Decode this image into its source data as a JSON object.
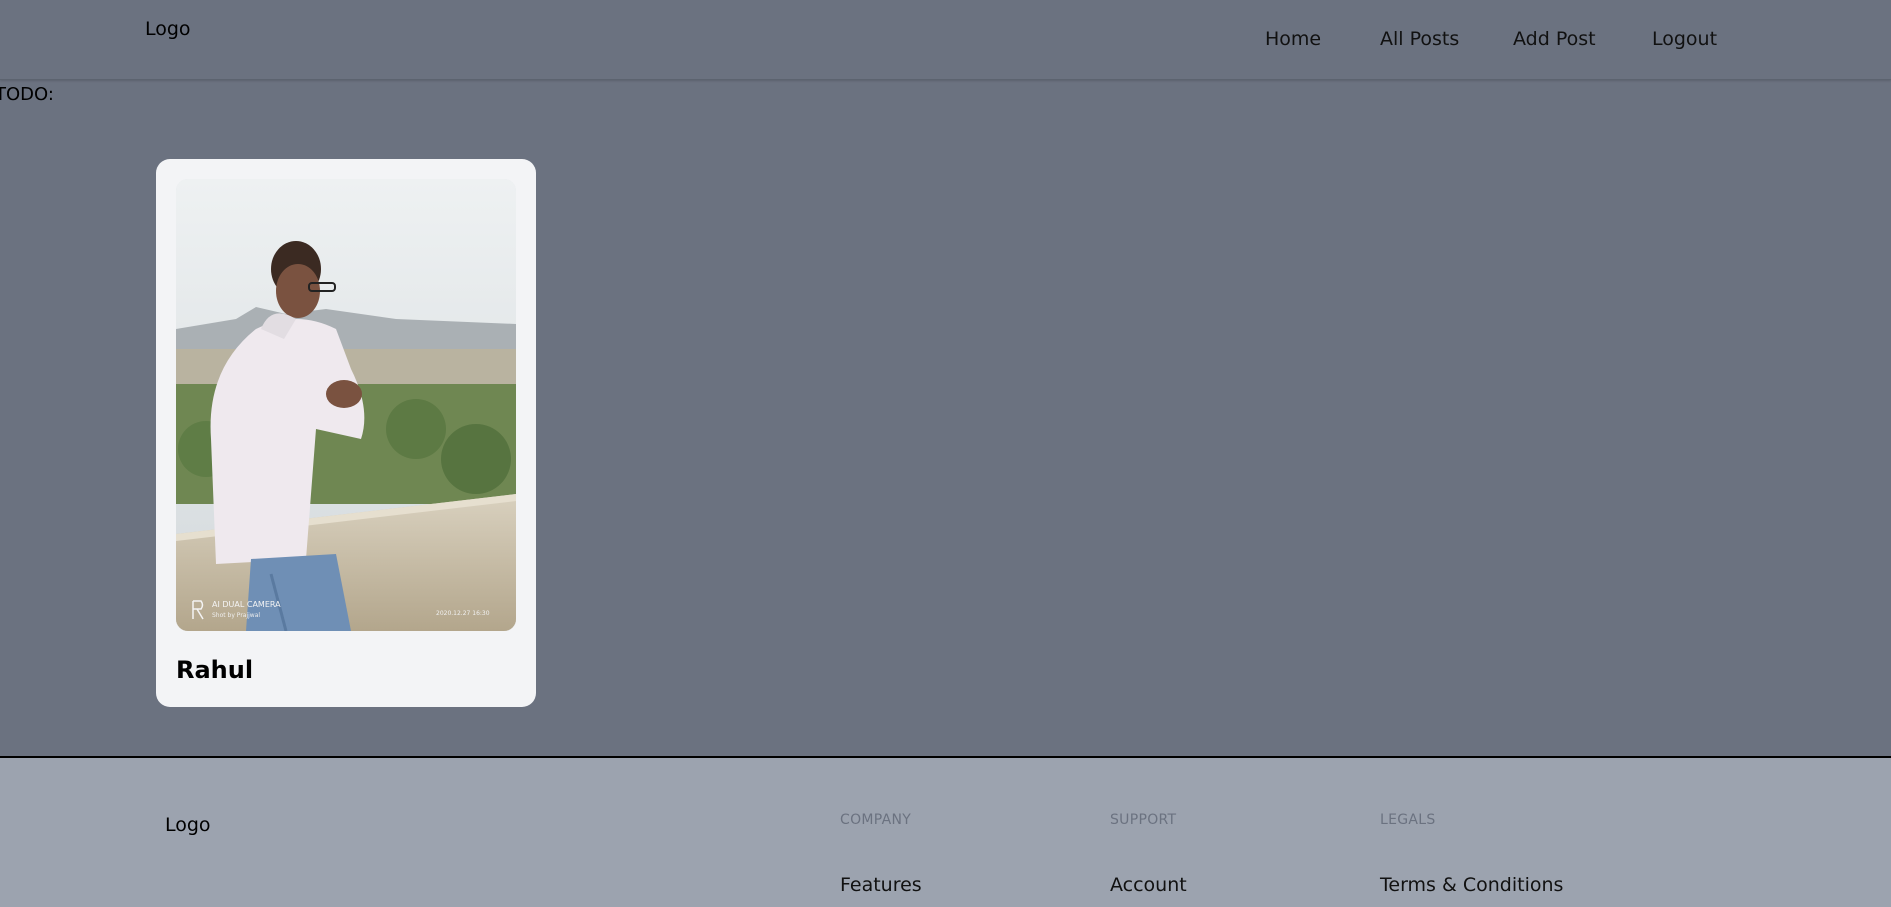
{
  "header": {
    "logo": "Logo",
    "nav": [
      "Home",
      "All Posts",
      "Add Post",
      "Logout"
    ]
  },
  "todo_label": "TODO:",
  "posts": [
    {
      "title": "Rahul",
      "image_watermark_brand": "AI DUAL CAMERA",
      "image_watermark_sub": "Shot by Prajjwal",
      "image_timestamp": "2020.12.27 16:30"
    }
  ],
  "footer": {
    "logo": "Logo",
    "columns": [
      {
        "heading": "COMPANY",
        "link": "Features"
      },
      {
        "heading": "SUPPORT",
        "link": "Account"
      },
      {
        "heading": "LEGALS",
        "link": "Terms & Conditions"
      }
    ]
  },
  "colors": {
    "page_bg": "#6b7280",
    "card_bg": "#f3f4f6",
    "footer_bg": "#9ca3af"
  }
}
